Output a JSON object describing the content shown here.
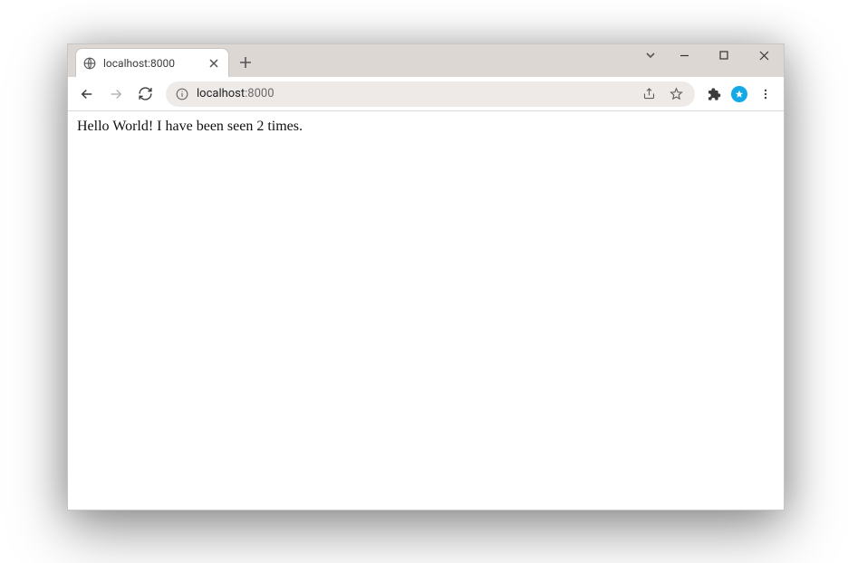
{
  "window": {
    "tab_title": "localhost:8000",
    "address_host": "localhost",
    "address_port": ":8000"
  },
  "page": {
    "body_text": "Hello World! I have been seen 2 times."
  }
}
